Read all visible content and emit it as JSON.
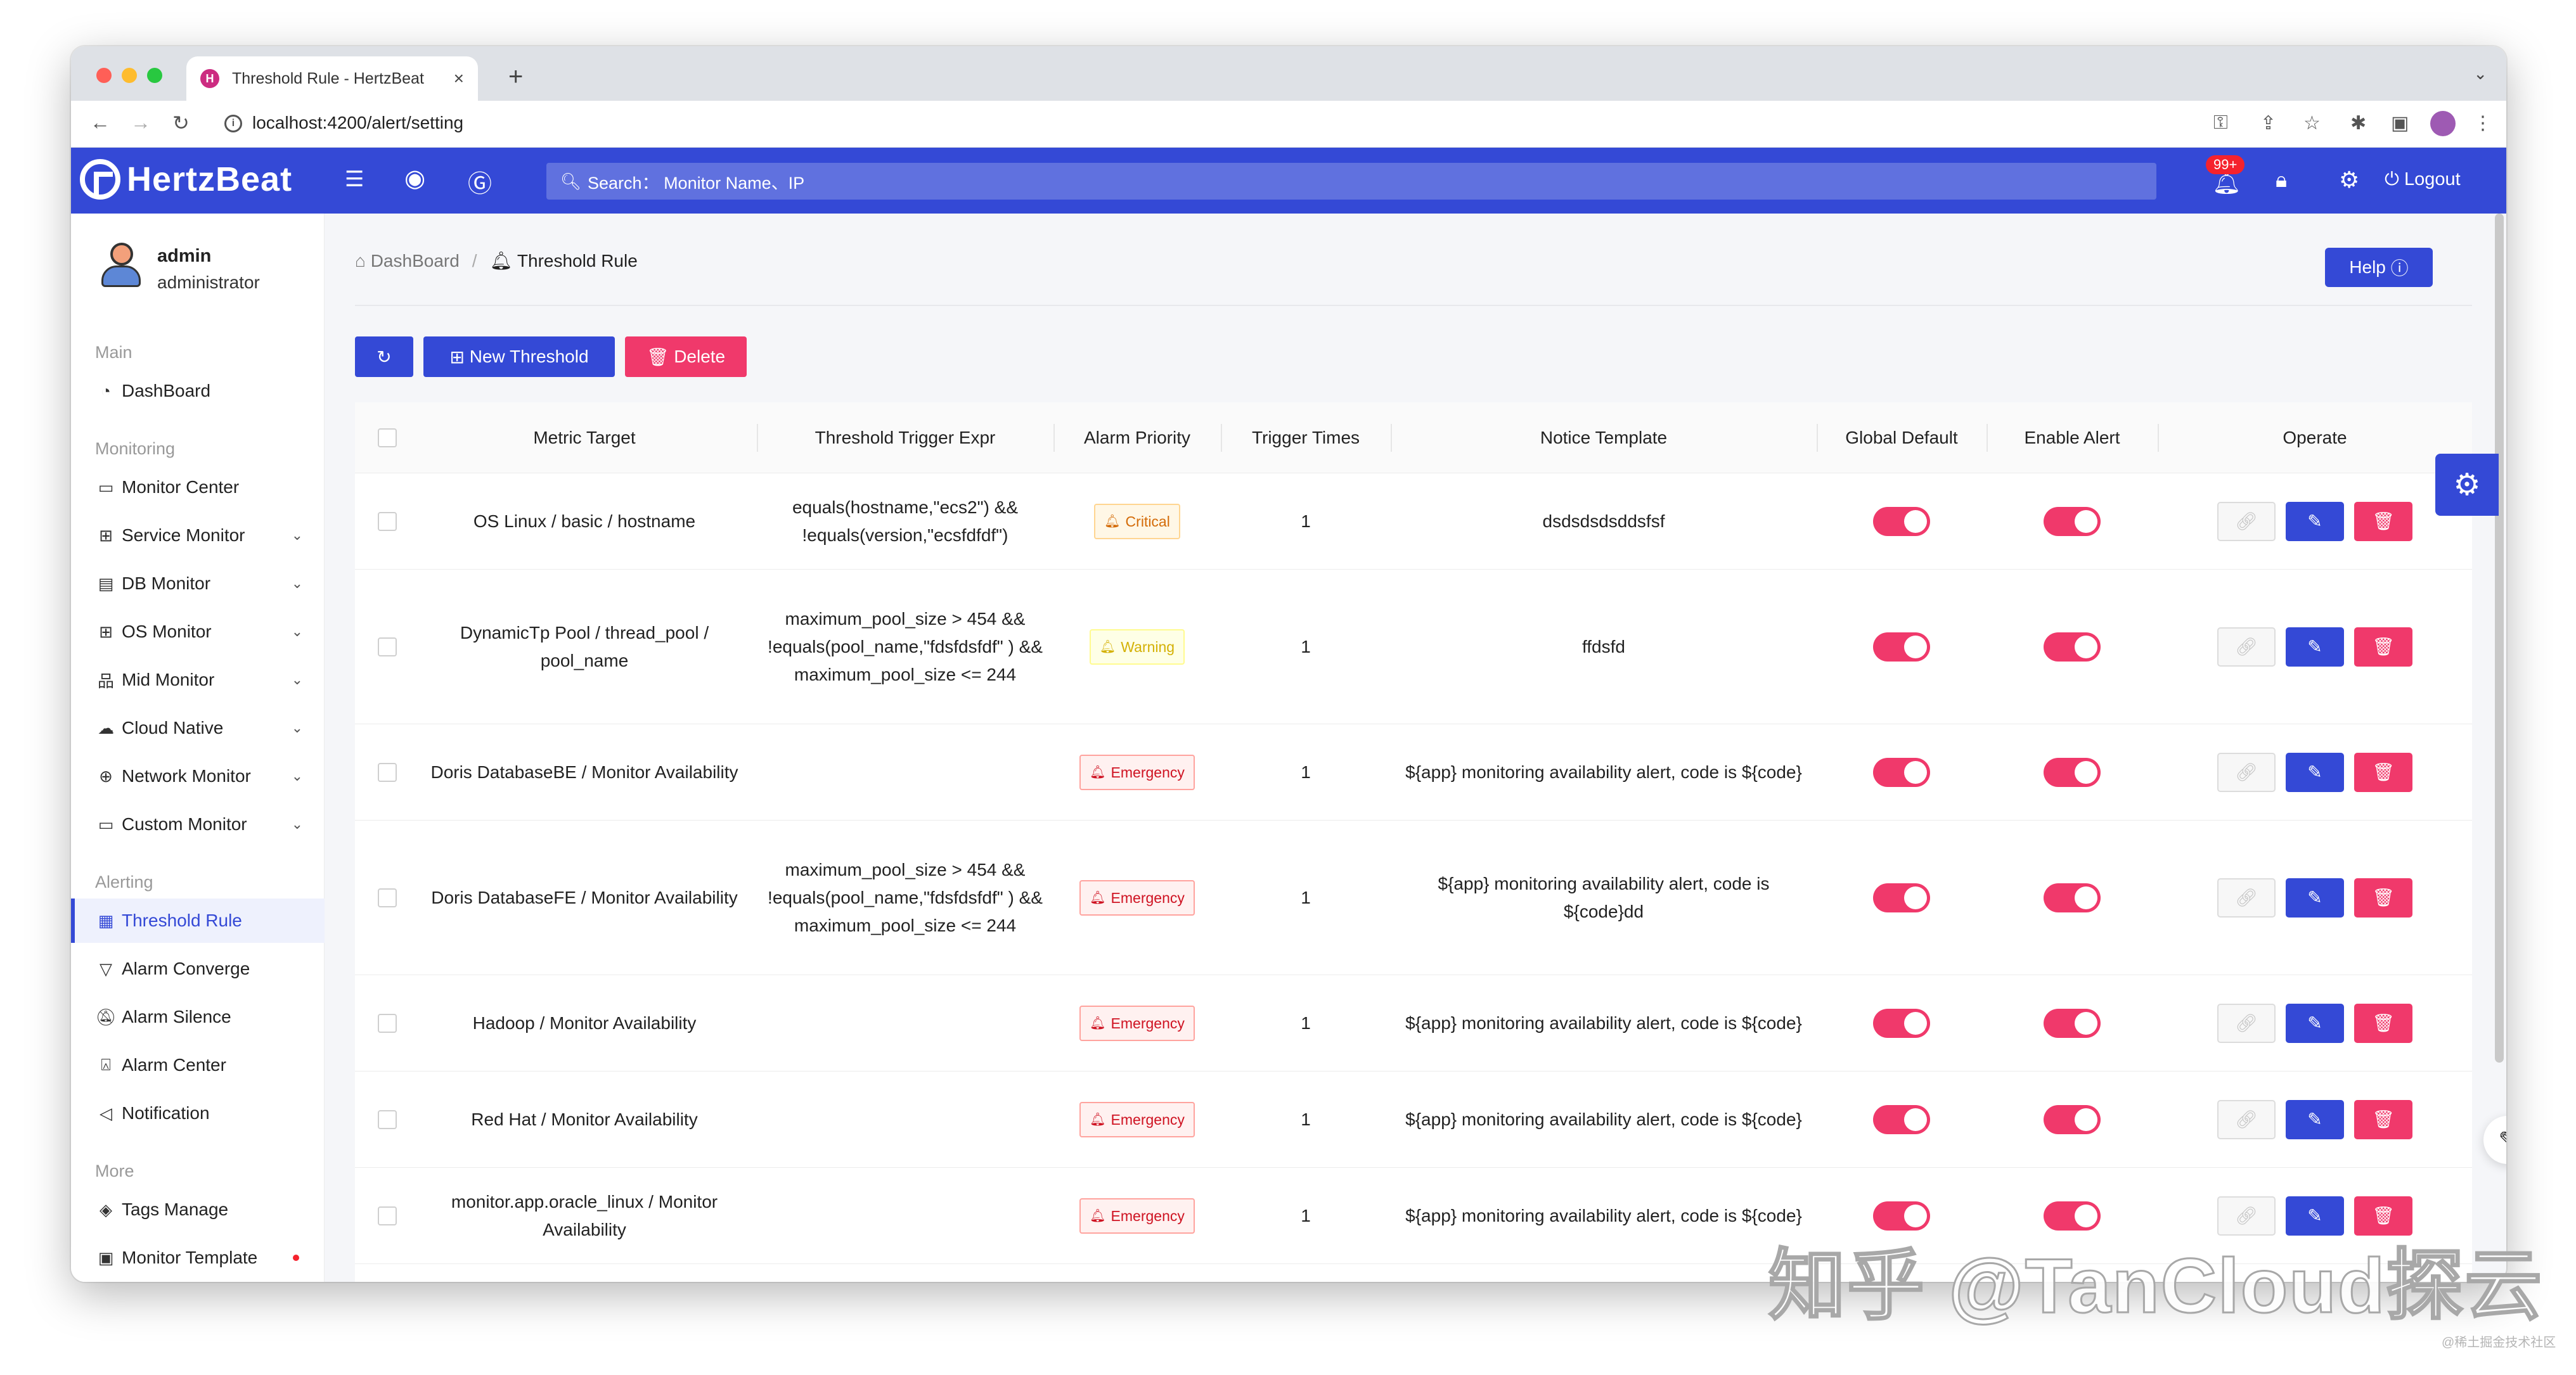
{
  "browser": {
    "tab_title": "Threshold Rule - HertzBeat",
    "url": "localhost:4200/alert/setting"
  },
  "header": {
    "logo": "HertzBeat",
    "search_placeholder": "Search： Monitor Name、IP",
    "notification_badge": "99+",
    "logout": "Logout"
  },
  "user": {
    "name": "admin",
    "role": "administrator"
  },
  "sidebar": {
    "sections": {
      "main": "Main",
      "monitoring": "Monitoring",
      "alerting": "Alerting",
      "more": "More"
    },
    "items": {
      "dashboard": "DashBoard",
      "monitor_center": "Monitor Center",
      "service_monitor": "Service Monitor",
      "db_monitor": "DB Monitor",
      "os_monitor": "OS Monitor",
      "mid_monitor": "Mid Monitor",
      "cloud_native": "Cloud Native",
      "network_monitor": "Network Monitor",
      "custom_monitor": "Custom Monitor",
      "threshold_rule": "Threshold Rule",
      "alarm_converge": "Alarm Converge",
      "alarm_silence": "Alarm Silence",
      "alarm_center": "Alarm Center",
      "notification": "Notification",
      "tags_manage": "Tags Manage",
      "monitor_template": "Monitor Template"
    }
  },
  "breadcrumb": {
    "home": "DashBoard",
    "current": "Threshold Rule"
  },
  "toolbar": {
    "help": "Help",
    "new_threshold": "New Threshold",
    "delete": "Delete"
  },
  "table": {
    "columns": {
      "metric_target": "Metric Target",
      "expr": "Threshold Trigger Expr",
      "priority": "Alarm Priority",
      "times": "Trigger Times",
      "template": "Notice Template",
      "global": "Global Default",
      "enable": "Enable Alert",
      "operate": "Operate"
    },
    "rows": [
      {
        "target": "OS Linux / basic / hostname",
        "expr": "equals(hostname,\"ecs2\") && !equals(version,\"ecsfdfdf\")",
        "priority": "Critical",
        "times": "1",
        "template": "dsdsdsdsddsfsf",
        "global_default": true,
        "enable_alert": true
      },
      {
        "target": "DynamicTp Pool / thread_pool / pool_name",
        "expr": "maximum_pool_size > 454 && !equals(pool_name,\"fdsfdsfdf\" ) && maximum_pool_size <= 244",
        "priority": "Warning",
        "times": "1",
        "template": "ffdsfd",
        "global_default": true,
        "enable_alert": true
      },
      {
        "target": "Doris DatabaseBE / Monitor Availability",
        "expr": "",
        "priority": "Emergency",
        "times": "1",
        "template": "${app} monitoring availability alert, code is ${code}",
        "global_default": true,
        "enable_alert": true
      },
      {
        "target": "Doris DatabaseFE / Monitor Availability",
        "expr": "maximum_pool_size > 454 && !equals(pool_name,\"fdsfdsfdf\" ) && maximum_pool_size <= 244",
        "priority": "Emergency",
        "times": "1",
        "template": "${app} monitoring availability alert, code is ${code}dd",
        "global_default": true,
        "enable_alert": true
      },
      {
        "target": "Hadoop / Monitor Availability",
        "expr": "",
        "priority": "Emergency",
        "times": "1",
        "template": "${app} monitoring availability alert, code is ${code}",
        "global_default": true,
        "enable_alert": true
      },
      {
        "target": "Red Hat / Monitor Availability",
        "expr": "",
        "priority": "Emergency",
        "times": "1",
        "template": "${app} monitoring availability alert, code is ${code}",
        "global_default": true,
        "enable_alert": true
      },
      {
        "target": "monitor.app.oracle_linux / Monitor Availability",
        "expr": "",
        "priority": "Emergency",
        "times": "1",
        "template": "${app} monitoring availability alert, code is ${code}",
        "global_default": true,
        "enable_alert": true
      }
    ]
  },
  "watermark": "知乎 @TanCloud探云",
  "watermark_small": "@稀土掘金技术社区",
  "colors": {
    "primary": "#3449d6",
    "danger": "#f0396b"
  }
}
